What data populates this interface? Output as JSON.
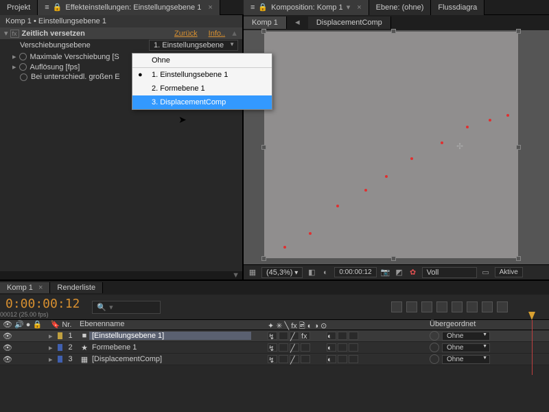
{
  "top_tabs": {
    "projekt": "Projekt",
    "effects_title": "Effekteinstellungen: Einstellungsebene 1",
    "komp": "Komposition: Komp 1",
    "ebene": "Ebene: (ohne)",
    "fluss": "Flussdiagra"
  },
  "effects": {
    "breadcrumb": "Komp 1 • Einstellungsebene 1",
    "name": "Zeitlich versetzen",
    "zuruck": "Zurück",
    "info": "Info..",
    "params": {
      "verschiebungsebene": "Verschiebungsebene",
      "verschiebungs_value": "1. Einstellungsebene",
      "max_verschiebung": "Maximale Verschiebung [S",
      "aufloesung": "Auflösung [fps]",
      "bei_untersch": "Bei unterschiedl. großen E"
    }
  },
  "dropdown": {
    "ohne": "Ohne",
    "opt1": "1. Einstellungsebene 1",
    "opt2": "2. Formebene 1",
    "opt3": "3. DisplacementComp"
  },
  "comp_tabs": {
    "komp1": "Komp 1",
    "disp": "DisplacementComp"
  },
  "comp_footer": {
    "zoom": "(45,3%)",
    "res": "Voll",
    "time": "0:00:00:12",
    "aktive": "Aktive"
  },
  "timeline": {
    "tabs": {
      "komp1": "Komp 1",
      "render": "Renderliste"
    },
    "timecode": "0:00:00:12",
    "timecode_sub": "00012 (25.00 fps)",
    "cols": {
      "nr": "Nr.",
      "name": "Ebenenname",
      "parent": "Übergeordnet"
    },
    "layers": [
      {
        "num": "1",
        "name": "[Einstellungsebene 1]",
        "color": "#c0a040",
        "icon": "■",
        "parent": "Ohne",
        "sel": true,
        "fx": true
      },
      {
        "num": "2",
        "name": "Formebene 1",
        "color": "#4060b0",
        "icon": "★",
        "parent": "Ohne",
        "sel": false,
        "fx": false
      },
      {
        "num": "3",
        "name": "[DisplacementComp]",
        "color": "#4060b0",
        "icon": "▦",
        "parent": "Ohne",
        "sel": false,
        "fx": false
      }
    ]
  },
  "chart_data": {
    "type": "scatter",
    "note": "Red dots in comp viewport, approximate normalized positions",
    "points": [
      {
        "x": 0.08,
        "y": 0.95
      },
      {
        "x": 0.18,
        "y": 0.89
      },
      {
        "x": 0.29,
        "y": 0.77
      },
      {
        "x": 0.4,
        "y": 0.7
      },
      {
        "x": 0.48,
        "y": 0.64
      },
      {
        "x": 0.58,
        "y": 0.56
      },
      {
        "x": 0.7,
        "y": 0.49
      },
      {
        "x": 0.8,
        "y": 0.42
      },
      {
        "x": 0.89,
        "y": 0.39
      },
      {
        "x": 0.96,
        "y": 0.37
      }
    ]
  }
}
